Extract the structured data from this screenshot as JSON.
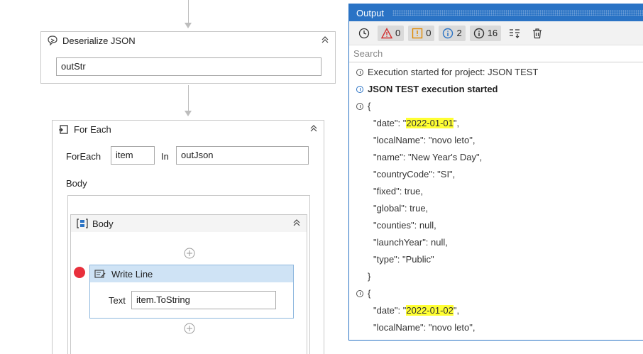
{
  "deserialize": {
    "title": "Deserialize JSON",
    "input_value": "outStr"
  },
  "foreach": {
    "title": "For Each",
    "foreach_label": "ForEach",
    "item_value": "item",
    "in_label": "In",
    "collection_value": "outJson",
    "body_label": "Body"
  },
  "body_seq": {
    "title": "Body"
  },
  "writeline": {
    "title": "Write Line",
    "text_label": "Text",
    "text_value": "item.ToString"
  },
  "output": {
    "title": "Output",
    "search_placeholder": "Search",
    "counts": {
      "errors": "0",
      "warnings": "0",
      "info": "2",
      "trace": "16"
    },
    "lines": [
      {
        "type": "info",
        "text": "Execution started for project: JSON TEST"
      },
      {
        "type": "info-blue-bold",
        "text": "JSON TEST execution started"
      },
      {
        "type": "info",
        "text": "{"
      },
      {
        "type": "indent",
        "pre": "\"date\": \"",
        "hl": "2022-01-01",
        "post": "\","
      },
      {
        "type": "indent",
        "text": "\"localName\": \"novo leto\","
      },
      {
        "type": "indent",
        "text": "\"name\": \"New Year's Day\","
      },
      {
        "type": "indent",
        "text": "\"countryCode\": \"SI\","
      },
      {
        "type": "indent",
        "text": "\"fixed\": true,"
      },
      {
        "type": "indent",
        "text": "\"global\": true,"
      },
      {
        "type": "indent",
        "text": "\"counties\": null,"
      },
      {
        "type": "indent",
        "text": "\"launchYear\": null,"
      },
      {
        "type": "indent",
        "text": "\"type\": \"Public\""
      },
      {
        "type": "close",
        "text": "}"
      },
      {
        "type": "info",
        "text": "{"
      },
      {
        "type": "indent",
        "pre": "\"date\": \"",
        "hl": "2022-01-02",
        "post": "\","
      },
      {
        "type": "indent",
        "text": "\"localName\": \"novo leto\","
      }
    ]
  },
  "colors": {
    "accent": "#2a73c5",
    "highlight": "#ffff33",
    "breakpoint": "#e8303c",
    "writeline_header": "#cfe3f5"
  }
}
